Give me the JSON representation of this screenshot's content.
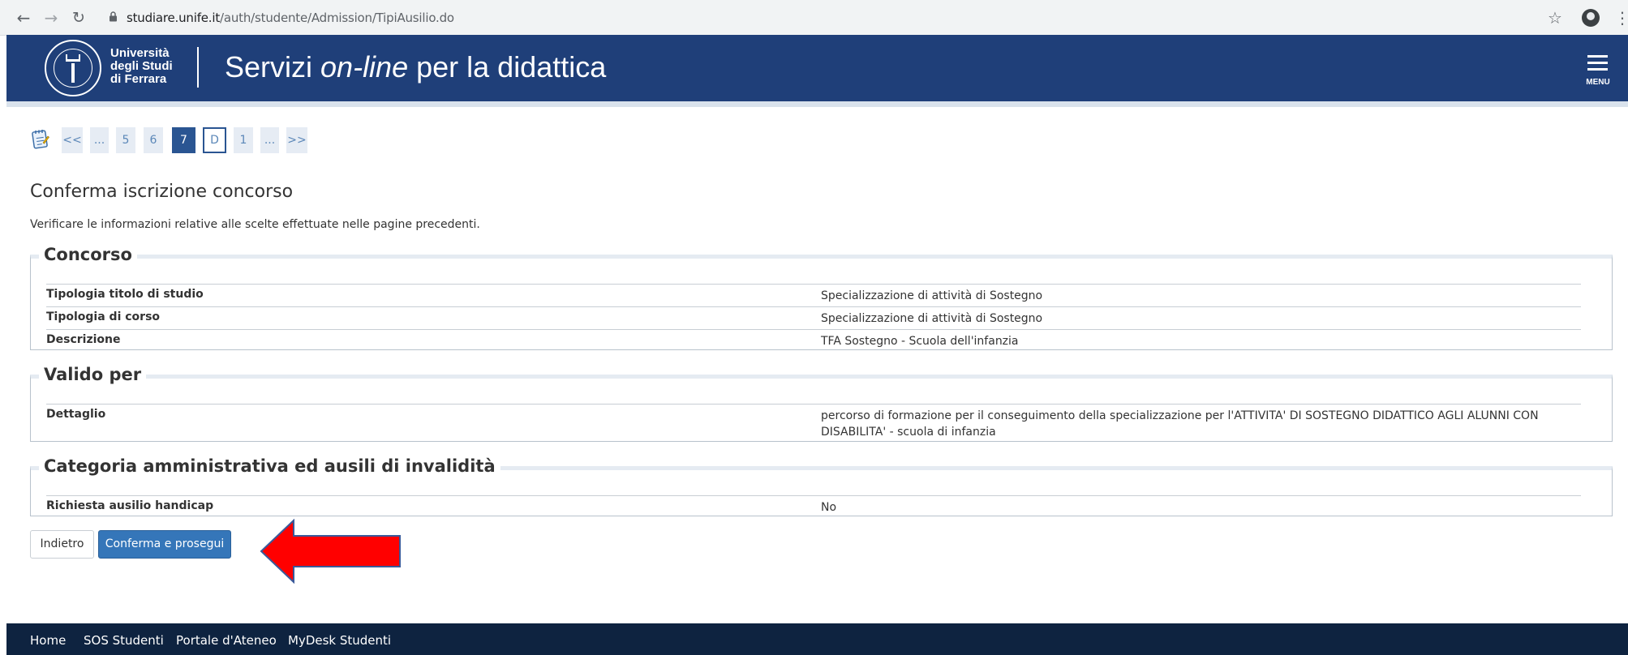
{
  "browser": {
    "url_host": "studiare.unife.it",
    "url_path": "/auth/studente/Admission/TipiAusilio.do"
  },
  "header": {
    "university": [
      "Università",
      "degli Studi",
      "di Ferrara"
    ],
    "title_pre": "Servizi ",
    "title_em": "on-line",
    "title_post": " per la didattica",
    "menu_label": "MENU"
  },
  "pager": [
    "<<",
    "...",
    "5",
    "6",
    "7",
    "D",
    "1",
    "...",
    ">>"
  ],
  "page": {
    "title": "Conferma iscrizione concorso",
    "intro": "Verificare le informazioni relative alle scelte effettuate nelle pagine precedenti."
  },
  "sections": {
    "concorso": {
      "legend": "Concorso",
      "rows": [
        {
          "label": "Tipologia titolo di studio",
          "value": "Specializzazione di attività di Sostegno"
        },
        {
          "label": "Tipologia di corso",
          "value": "Specializzazione di attività di Sostegno"
        },
        {
          "label": "Descrizione",
          "value": "TFA Sostegno - Scuola dell'infanzia"
        }
      ]
    },
    "valido": {
      "legend": "Valido per",
      "rows": [
        {
          "label": "Dettaglio",
          "value": "percorso di formazione per il conseguimento della specializzazione per l'ATTIVITA' DI SOSTEGNO DIDATTICO AGLI ALUNNI CON DISABILITA' - scuola di infanzia"
        }
      ]
    },
    "categoria": {
      "legend": "Categoria amministrativa ed ausili di invalidità",
      "rows": [
        {
          "label": "Richiesta ausilio handicap",
          "value": "No"
        }
      ]
    }
  },
  "buttons": {
    "back": "Indietro",
    "confirm": "Conferma e prosegui"
  },
  "footer": [
    "Home",
    "SOS Studenti",
    "Portale d'Ateneo",
    "MyDesk Studenti"
  ],
  "colors": {
    "header_bg": "#1f3f79",
    "footer_bg": "#0e2340",
    "primary_button": "#3576b9",
    "annotation_arrow": "#ff0000"
  }
}
